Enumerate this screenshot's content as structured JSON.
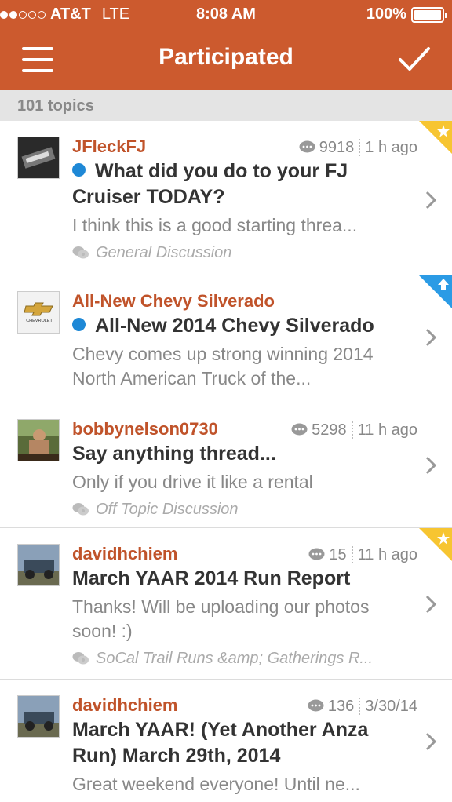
{
  "status_bar": {
    "carrier": "AT&T",
    "network": "LTE",
    "time": "8:08 AM",
    "battery": "100%",
    "signal_bars_filled": 2,
    "signal_bars_total": 5,
    "battery_level": 1.0
  },
  "nav": {
    "title": "Participated"
  },
  "topic_count": "101 topics",
  "colors": {
    "brand": "#cc5a2e",
    "author": "#c0532a",
    "unread_dot": "#1e88d6",
    "star_badge": "#f7c531",
    "up_badge": "#2b9be5"
  },
  "topics": [
    {
      "author": "JFleckFJ",
      "replies": "9918",
      "time": "1 h ago",
      "title": "What did you do to your FJ Cruiser TODAY?",
      "unread": true,
      "snippet": "I think this is a good starting threa...",
      "category": "General Discussion",
      "badge": "star",
      "avatar": "fj-avatar"
    },
    {
      "author": "All-New Chevy Silverado",
      "replies": "",
      "time": "",
      "title": "All-New 2014 Chevy Silverado",
      "unread": true,
      "snippet": "Chevy comes up strong winning 2014 North American Truck of the...",
      "category": "",
      "badge": "up",
      "avatar": "chevrolet-logo",
      "avatar_text": "CHEVROLET"
    },
    {
      "author": "bobbynelson0730",
      "replies": "5298",
      "time": "11 h ago",
      "title": "Say anything thread...",
      "unread": false,
      "snippet": "Only if you drive it like a rental",
      "category": "Off Topic Discussion",
      "badge": "",
      "avatar": "people-avatar"
    },
    {
      "author": "davidhchiem",
      "replies": "15",
      "time": "11 h ago",
      "title": "March YAAR 2014 Run Report",
      "unread": false,
      "snippet": "Thanks! Will be uploading our photos soon! :)",
      "category": "SoCal Trail Runs &amp; Gatherings R...",
      "badge": "star",
      "avatar": "truck-avatar"
    },
    {
      "author": "davidhchiem",
      "replies": "136",
      "time": "3/30/14",
      "title": "March YAAR!  (Yet Another Anza Run)  March  29th, 2014",
      "unread": false,
      "snippet": "Great weekend everyone! Until ne...",
      "category": "",
      "badge": "",
      "avatar": "truck-avatar"
    }
  ]
}
